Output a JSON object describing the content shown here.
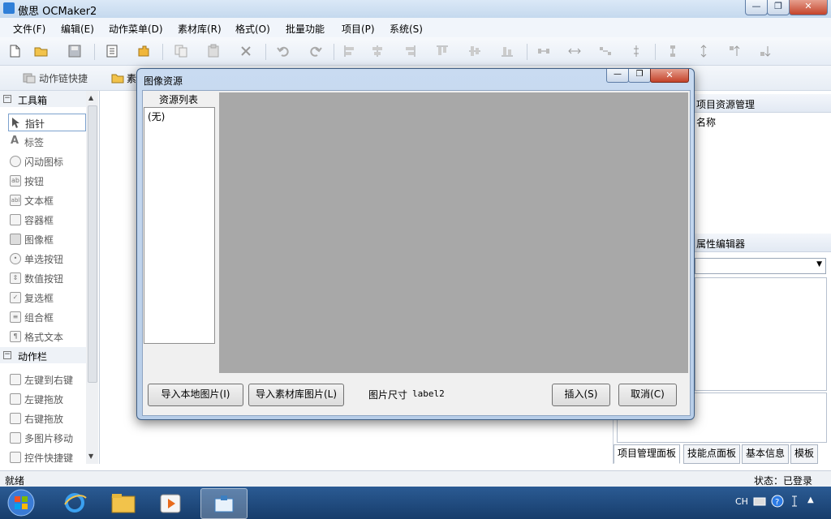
{
  "window": {
    "title": "傲思 OCMaker2",
    "minimize": "—",
    "maximize": "❐",
    "close": "✕"
  },
  "menu": [
    "文件(F)",
    "编辑(E)",
    "动作菜单(D)",
    "素材库(R)",
    "格式(O)",
    "批量功能",
    "项目(P)",
    "系统(S)"
  ],
  "toolbar2": {
    "action_shortcut": "动作链快捷",
    "material": "素"
  },
  "toolbox": {
    "tools_header": "工具箱",
    "tools": [
      "指针",
      "标签",
      "闪动图标",
      "按钮",
      "文本框",
      "容器框",
      "图像框",
      "单选按钮",
      "数值按钮",
      "复选框",
      "组合框",
      "格式文本"
    ],
    "actions_header": "动作栏",
    "actions": [
      "左键到右键",
      "左键拖放",
      "右键拖放",
      "多图片移动",
      "控件快捷键"
    ]
  },
  "right_panel": {
    "project_header": "项目资源管理",
    "name_col": "名称",
    "props_header": "属性编辑器",
    "tabs": [
      "项目管理面板",
      "技能点面板",
      "基本信息",
      "模板"
    ]
  },
  "status": {
    "left": "就绪",
    "right": "状态：已登录"
  },
  "tray": {
    "lang": "CH"
  },
  "dialog": {
    "title": "图像资源",
    "list_header": "资源列表",
    "list_items": [
      "(无)"
    ],
    "import_local": "导入本地图片(I)",
    "import_library": "导入素材库图片(L)",
    "size_label": "图片尺寸",
    "size_value": "label2",
    "insert": "插入(S)",
    "cancel": "取消(C)"
  }
}
